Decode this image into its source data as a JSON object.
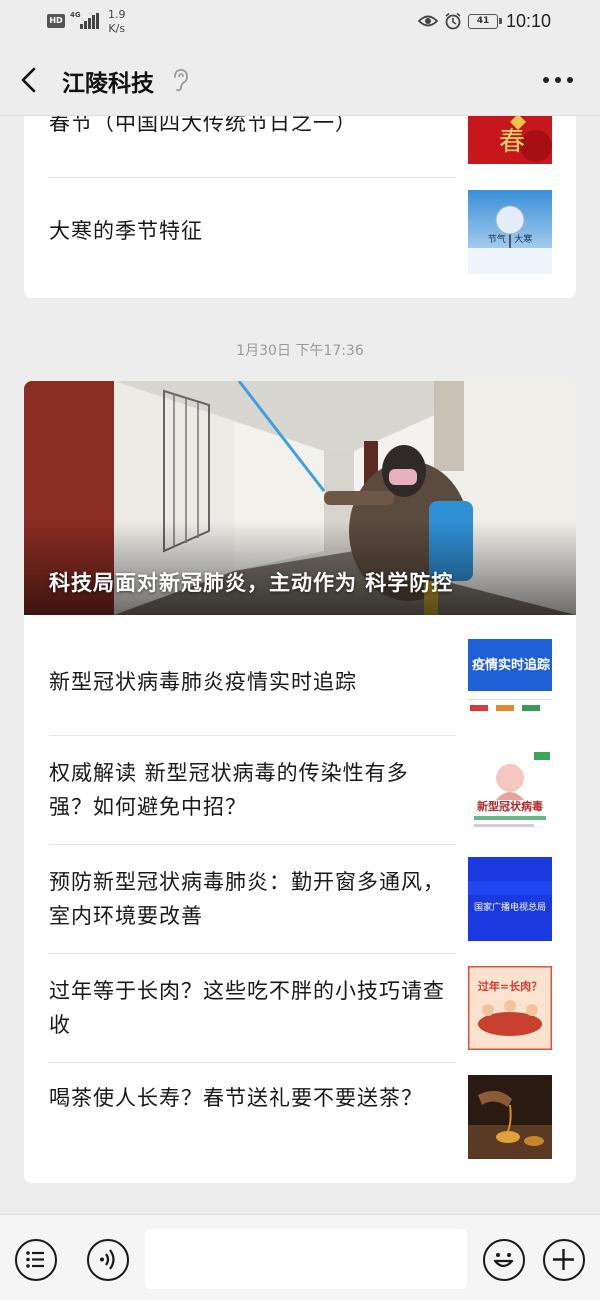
{
  "status_bar": {
    "hd": "HD",
    "network": "4G",
    "speed_value": "1.9",
    "speed_unit": "K/s",
    "battery": "41",
    "time": "10:10"
  },
  "nav": {
    "title": "江陵科技"
  },
  "card1": {
    "items": [
      {
        "title": "春节（中国四大传统节日之一）",
        "thumb": "spring-festival-thumbnail"
      },
      {
        "title": "大寒的季节特征",
        "thumb": "great-cold-snow-tree-thumbnail",
        "thumb_text": "节气 · 大寒"
      }
    ]
  },
  "timestamp": "1月30日 下午17:36",
  "card2": {
    "hero_title": "科技局面对新冠肺炎，主动作为 科学防控",
    "items": [
      {
        "title": "新型冠状病毒肺炎疫情实时追踪",
        "thumb_text": "疫情实时追踪"
      },
      {
        "title": "权威解读 新型冠状病毒的传染性有多强？如何避免中招？",
        "thumb_text": "新型冠状病毒"
      },
      {
        "title": "预防新型冠状病毒肺炎：勤开窗多通风，室内环境要改善",
        "thumb_text": "国家广播电视总局"
      },
      {
        "title": "过年等于长肉？这些吃不胖的小技巧请查收",
        "thumb_text": "过年=长肉？"
      },
      {
        "title": "喝茶使人长寿？春节送礼要不要送茶？",
        "thumb": "tea-pouring-thumbnail"
      }
    ]
  },
  "colors": {
    "background": "#ededed",
    "card": "#ffffff",
    "text": "#191919",
    "muted": "#9a9a9a"
  }
}
